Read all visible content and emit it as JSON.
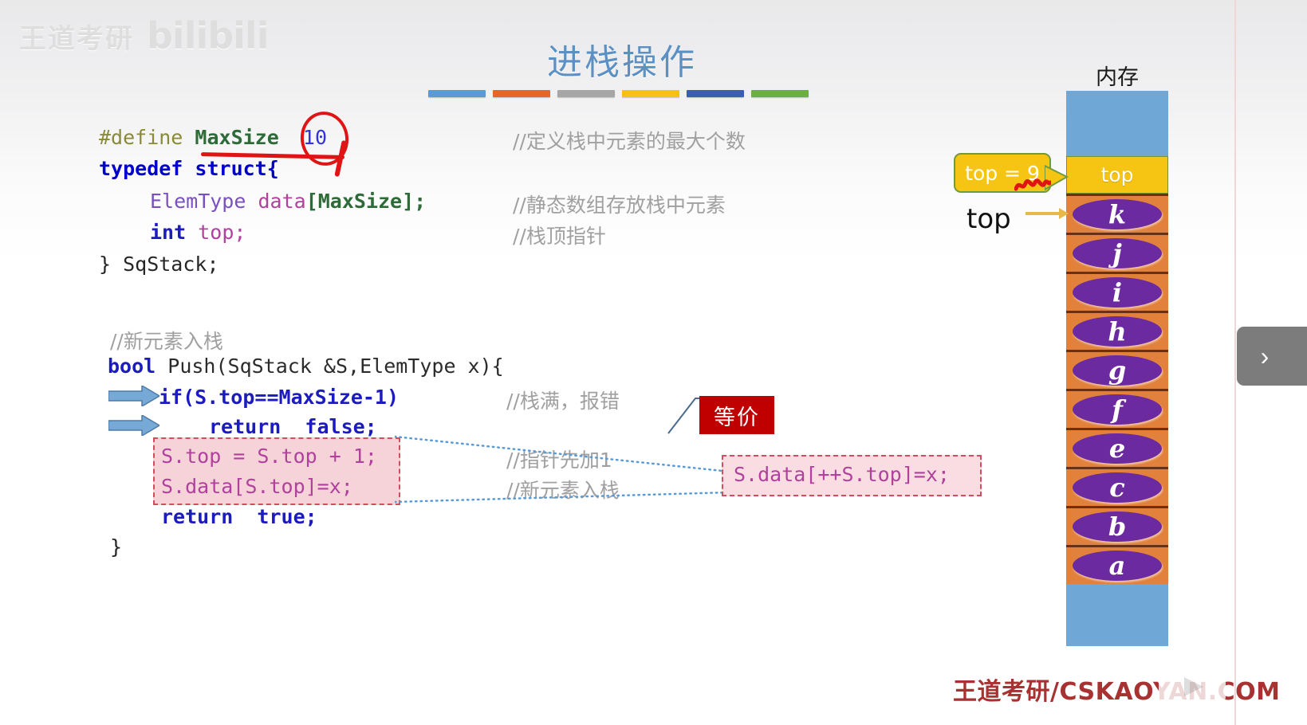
{
  "slide": {
    "title": "进栈操作",
    "memory_label": "内存",
    "watermark_top_cn": "王道考研",
    "watermark_top_brand": "bilibili",
    "watermark_bottom": "王道考研/CSKAOYAN.COM",
    "rule_colors": [
      "#5b9bd5",
      "#e2672a",
      "#a6a6a6",
      "#f5c211",
      "#3b5fad",
      "#6aae44"
    ]
  },
  "code": {
    "struct": {
      "l1_define": "#define",
      "l1_name": "MaxSize",
      "l1_value": "10",
      "l1_comment": "//定义栈中元素的最大个数",
      "l2": "typedef struct{",
      "l3_type": "ElemType",
      "l3_field": "data",
      "l3_index": "[MaxSize];",
      "l3_comment": "//静态数组存放栈中元素",
      "l4_type": "int",
      "l4_field": "top;",
      "l4_comment": "//栈顶指针",
      "l5": "} SqStack;"
    },
    "push": {
      "comment_head": "//新元素入栈",
      "signature_kw": "bool",
      "signature_rest": " Push(SqStack &S,ElemType x){",
      "if_line": "if(S.top==MaxSize-1)",
      "if_comment": "//栈满，报错",
      "return_false": "return  false;",
      "stmt1": "S.top = S.top + 1;",
      "stmt1_comment": "//指针先加1",
      "stmt2": "S.data[S.top]=x;",
      "stmt2_comment": "//新元素入栈",
      "return_true": "return  true;",
      "close": "}"
    },
    "equivalent": {
      "badge": "等价",
      "expr": "S.data[++S.top]=x;"
    }
  },
  "memory": {
    "callout_text": "top = 9",
    "pointer_label": "top",
    "top_cell_label": "top",
    "stack_items": [
      "k",
      "j",
      "i",
      "h",
      "g",
      "f",
      "e",
      "c",
      "b",
      "a"
    ]
  },
  "controls": {
    "edge_tab_icon": "chevron-right"
  }
}
